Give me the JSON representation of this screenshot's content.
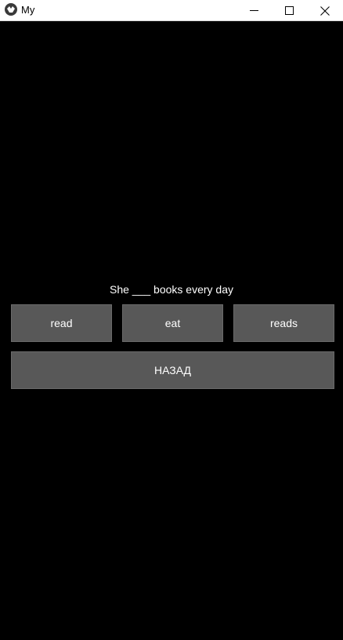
{
  "window": {
    "title": "My",
    "app_icon": "kivy-icon",
    "controls": [
      "minimize-icon",
      "maximize-icon",
      "close-icon"
    ]
  },
  "quiz": {
    "question": "She ___ books every day",
    "options": [
      "read",
      "eat",
      "reads"
    ],
    "back_label": "НАЗАД"
  },
  "colors": {
    "background": "#000000",
    "button": "#585858",
    "text": "#ffffff",
    "titlebar": "#ffffff"
  }
}
